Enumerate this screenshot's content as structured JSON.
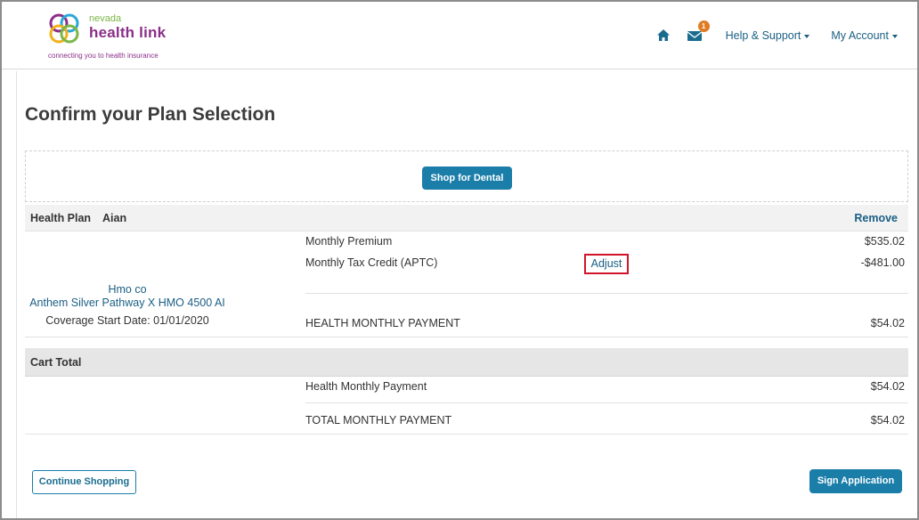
{
  "header": {
    "logo_small": "nevada",
    "logo_main": "health link",
    "logo_tagline": "connecting you to health insurance",
    "messages_badge": "1",
    "help_label": "Help & Support",
    "account_label": "My Account"
  },
  "page": {
    "title": "Confirm your Plan Selection",
    "shop_dental_label": "Shop for Dental"
  },
  "health_plan": {
    "header_label": "Health Plan",
    "member_name": "Aian",
    "remove_label": "Remove",
    "carrier": "Hmo co",
    "plan_name": "Anthem Silver Pathway X HMO 4500 AI",
    "coverage_start": "Coverage Start Date: 01/01/2020",
    "monthly_premium_label": "Monthly Premium",
    "monthly_premium_value": "$535.02",
    "tax_credit_label": "Monthly Tax Credit (APTC)",
    "adjust_label": "Adjust",
    "tax_credit_value": "-$481.00",
    "monthly_payment_label": "HEALTH MONTHLY PAYMENT",
    "monthly_payment_value": "$54.02"
  },
  "cart": {
    "header_label": "Cart Total",
    "health_payment_label": "Health Monthly Payment",
    "health_payment_value": "$54.02",
    "total_label": "TOTAL MONTHLY PAYMENT",
    "total_value": "$54.02"
  },
  "actions": {
    "continue_label": "Continue Shopping",
    "sign_label": "Sign Application"
  },
  "colors": {
    "primary": "#1a7ea9",
    "link": "#1a5f84",
    "brand_purple": "#8a2f89",
    "brand_green": "#7ab648",
    "badge": "#e07b22",
    "highlight_border": "#d2142a"
  }
}
